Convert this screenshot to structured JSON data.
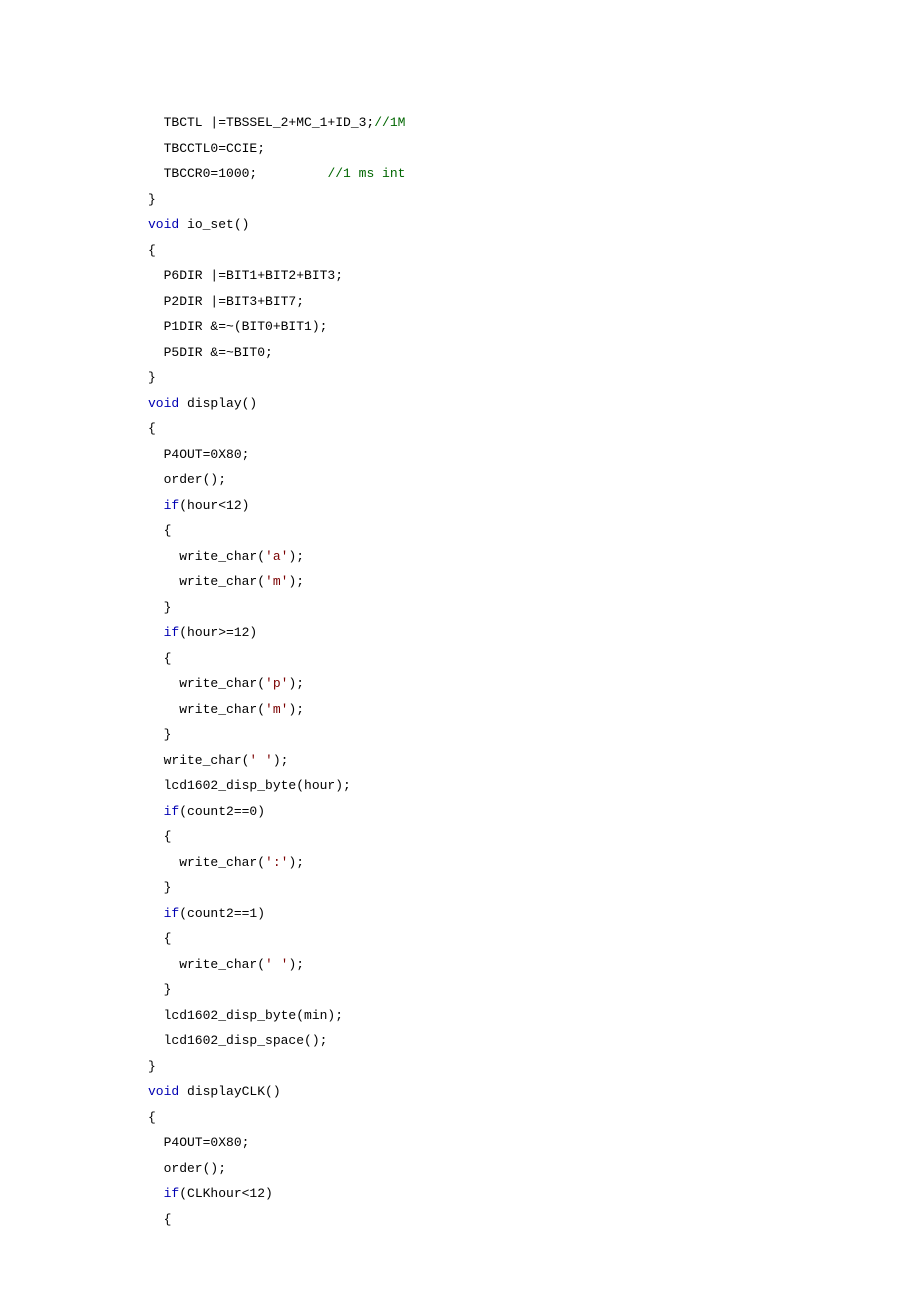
{
  "code": {
    "lines": [
      [
        [
          "  TBCTL |=TBSSEL_2+MC_1+ID_3;"
        ],
        [
          "//1M",
          "cm"
        ]
      ],
      [
        [
          "  TBCCTL0=CCIE;"
        ]
      ],
      [
        [
          "  TBCCR0=1000;         "
        ],
        [
          "//1 ms int",
          "cm"
        ]
      ],
      [
        [
          "}"
        ]
      ],
      [
        [
          "void",
          "kw"
        ],
        [
          " io_set()"
        ]
      ],
      [
        [
          "{"
        ]
      ],
      [
        [
          "  P6DIR |=BIT1+BIT2+BIT3;"
        ]
      ],
      [
        [
          "  P2DIR |=BIT3+BIT7;"
        ]
      ],
      [
        [
          "  P1DIR &=~(BIT0+BIT1);"
        ]
      ],
      [
        [
          "  P5DIR &=~BIT0;"
        ]
      ],
      [
        [
          "}"
        ]
      ],
      [
        [
          "void",
          "kw"
        ],
        [
          " display()"
        ]
      ],
      [
        [
          "{"
        ]
      ],
      [
        [
          "  P4OUT=0X80;"
        ]
      ],
      [
        [
          "  order();"
        ]
      ],
      [
        [
          "  "
        ],
        [
          "if",
          "kw"
        ],
        [
          "(hour<12)"
        ]
      ],
      [
        [
          "  {"
        ]
      ],
      [
        [
          "    write_char("
        ],
        [
          "'a'",
          "s"
        ],
        [
          ");"
        ]
      ],
      [
        [
          "    write_char("
        ],
        [
          "'m'",
          "s"
        ],
        [
          ");"
        ]
      ],
      [
        [
          "  }"
        ]
      ],
      [
        [
          "  "
        ],
        [
          "if",
          "kw"
        ],
        [
          "(hour>=12)"
        ]
      ],
      [
        [
          "  {"
        ]
      ],
      [
        [
          "    write_char("
        ],
        [
          "'p'",
          "s"
        ],
        [
          ");"
        ]
      ],
      [
        [
          "    write_char("
        ],
        [
          "'m'",
          "s"
        ],
        [
          ");"
        ]
      ],
      [
        [
          "  }"
        ]
      ],
      [
        [
          "  write_char("
        ],
        [
          "' '",
          "s"
        ],
        [
          ");"
        ]
      ],
      [
        [
          "  lcd1602_disp_byte(hour);"
        ]
      ],
      [
        [
          "  "
        ],
        [
          "if",
          "kw"
        ],
        [
          "(count2==0)"
        ]
      ],
      [
        [
          "  {"
        ]
      ],
      [
        [
          "    write_char("
        ],
        [
          "':'",
          "s"
        ],
        [
          ");"
        ]
      ],
      [
        [
          "  }"
        ]
      ],
      [
        [
          "  "
        ],
        [
          "if",
          "kw"
        ],
        [
          "(count2==1)"
        ]
      ],
      [
        [
          "  {"
        ]
      ],
      [
        [
          "    write_char("
        ],
        [
          "' '",
          "s"
        ],
        [
          ");"
        ]
      ],
      [
        [
          "  }"
        ]
      ],
      [
        [
          "  lcd1602_disp_byte(min);"
        ]
      ],
      [
        [
          "  lcd1602_disp_space();"
        ]
      ],
      [
        [
          "}"
        ]
      ],
      [
        [
          "void",
          "kw"
        ],
        [
          " displayCLK()"
        ]
      ],
      [
        [
          "{"
        ]
      ],
      [
        [
          "  P4OUT=0X80;"
        ]
      ],
      [
        [
          "  order();"
        ]
      ],
      [
        [
          "  "
        ],
        [
          "if",
          "kw"
        ],
        [
          "(CLKhour<12)"
        ]
      ],
      [
        [
          "  {"
        ]
      ]
    ]
  }
}
